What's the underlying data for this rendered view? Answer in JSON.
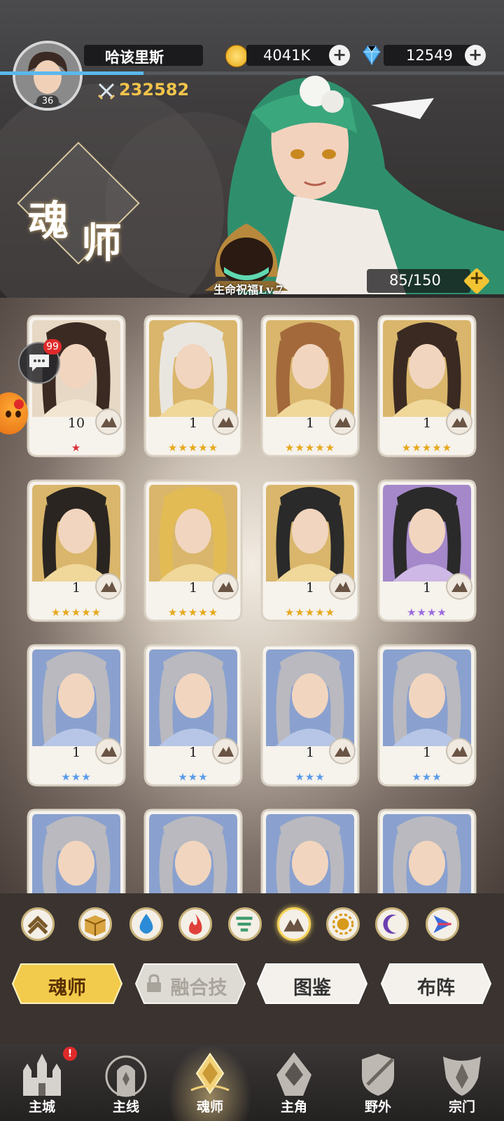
{
  "player": {
    "name": "哈该里斯",
    "level": "36",
    "power": "232582"
  },
  "resources": {
    "gold": "4041K",
    "diamonds": "12549"
  },
  "banner": {
    "title_char1": "魂",
    "title_char2": "师",
    "blessing": "生命祝福Lv.7",
    "capacity": "85/150"
  },
  "chat": {
    "badge": "99"
  },
  "heroes": [
    {
      "level": "10",
      "stars": "★",
      "star_color": "#d8323a"
    },
    {
      "level": "1",
      "stars": "★★★★★",
      "star_color": "#e6a81c"
    },
    {
      "level": "1",
      "stars": "★★★★★",
      "star_color": "#e6a81c"
    },
    {
      "level": "1",
      "stars": "★★★★★",
      "star_color": "#e6a81c"
    },
    {
      "level": "1",
      "stars": "★★★★★",
      "star_color": "#e6a81c"
    },
    {
      "level": "1",
      "stars": "★★★★★",
      "star_color": "#e6a81c"
    },
    {
      "level": "1",
      "stars": "★★★★★",
      "star_color": "#e6a81c"
    },
    {
      "level": "1",
      "stars": "★★★★",
      "star_color": "#9b6be0"
    },
    {
      "level": "1",
      "stars": "★★★",
      "star_color": "#5a9be8"
    },
    {
      "level": "1",
      "stars": "★★★",
      "star_color": "#5a9be8"
    },
    {
      "level": "1",
      "stars": "★★★",
      "star_color": "#5a9be8"
    },
    {
      "level": "1",
      "stars": "★★★",
      "star_color": "#5a9be8"
    }
  ],
  "filters": [
    "rank-up-icon",
    "box-icon",
    "water-icon",
    "fire-icon",
    "wind-icon",
    "earth-icon",
    "light-icon",
    "dark-icon",
    "arcane-icon"
  ],
  "tabs": {
    "hunshi": "魂师",
    "fusion": "融合技",
    "atlas": "图鉴",
    "formation": "布阵"
  },
  "nav": {
    "city": "主城",
    "main_line": "主线",
    "hunshi": "魂师",
    "protagonist": "主角",
    "wild": "野外",
    "sect": "宗门",
    "city_badge": "!"
  }
}
